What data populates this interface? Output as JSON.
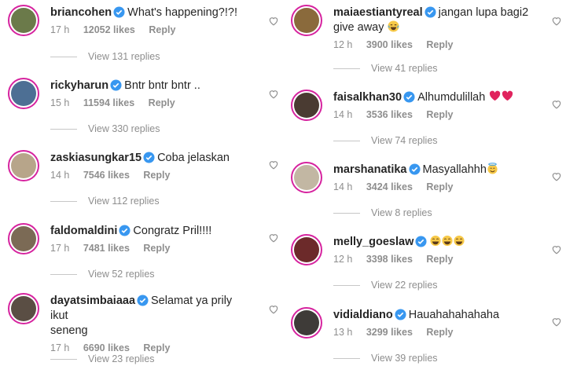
{
  "colors": {
    "text": "#262626",
    "muted": "#8e8e8e",
    "verified": "#3897f0",
    "ring": "#d6249f",
    "heart_emoji": "#e0245e"
  },
  "left_column": [
    {
      "username": "briancohen",
      "text": "What's happening?!?!",
      "time": "17 h",
      "likes": "12052 likes",
      "reply": "Reply",
      "replies": "View 131 replies",
      "avatar_color": "#6b7a4a"
    },
    {
      "username": "rickyharun",
      "text": "Bntr bntr bntr ..",
      "time": "15 h",
      "likes": "11594 likes",
      "reply": "Reply",
      "replies": "View 330 replies",
      "avatar_color": "#4d6f94"
    },
    {
      "username": "zaskiasungkar15",
      "text": "Coba jelaskan",
      "time": "14 h",
      "likes": "7546 likes",
      "reply": "Reply",
      "replies": "View 112 replies",
      "avatar_color": "#b7a58a"
    },
    {
      "username": "faldomaldini",
      "text": "Congratz Pril!!!!",
      "time": "17 h",
      "likes": "7481 likes",
      "reply": "Reply",
      "replies": "View 52 replies",
      "avatar_color": "#7b6a55"
    },
    {
      "username": "dayatsimbaiaaa",
      "text_line1": "Selamat ya prily ikut",
      "text_line2": "seneng",
      "time": "17 h",
      "likes": "6690 likes",
      "reply": "Reply",
      "replies": "View 23 replies",
      "avatar_color": "#5a4e44"
    }
  ],
  "right_column": [
    {
      "username": "maiaestiantyreal",
      "text_line1": "jangan lupa bagi2",
      "text_line2": "give away",
      "emoji": "laughing-emoji",
      "time": "12 h",
      "likes": "3900 likes",
      "reply": "Reply",
      "replies": "View 41 replies",
      "avatar_color": "#8a6a3c"
    },
    {
      "username": "faisalkhan30",
      "text": "Alhumdulillah",
      "emoji": "two-hearts-emoji",
      "time": "14 h",
      "likes": "3536 likes",
      "reply": "Reply",
      "replies": "View 74 replies",
      "avatar_color": "#4a3b32"
    },
    {
      "username": "marshanatika",
      "text": "Masyallahhh",
      "emoji": "halo-smile-emoji",
      "time": "14 h",
      "likes": "3424 likes",
      "reply": "Reply",
      "replies": "View 8 replies",
      "avatar_color": "#c2b7a3"
    },
    {
      "username": "melly_goeslaw",
      "text": "",
      "emoji": "three-laughing-emoji",
      "time": "12 h",
      "likes": "3398 likes",
      "reply": "Reply",
      "replies": "View 22 replies",
      "avatar_color": "#6c2a2a"
    },
    {
      "username": "vidialdiano",
      "text": "Hauahahahahaha",
      "time": "13 h",
      "likes": "3299 likes",
      "reply": "Reply",
      "replies": "View 39 replies",
      "avatar_color": "#3e3b38"
    }
  ]
}
